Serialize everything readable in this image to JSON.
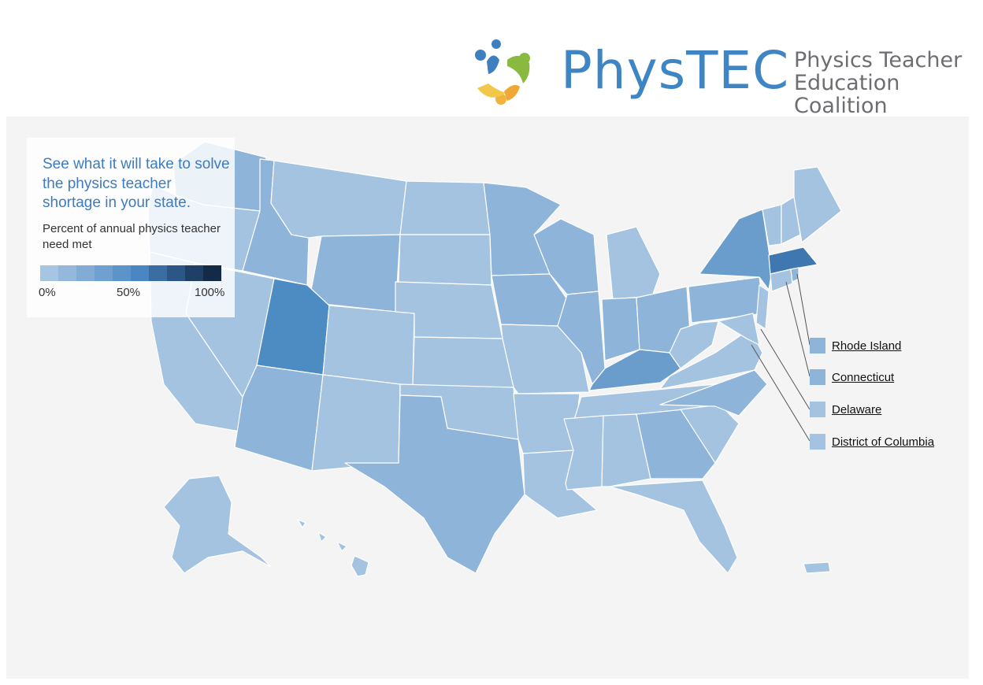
{
  "brand": {
    "name": "PhysTEC",
    "tagline_line1": "Physics Teacher",
    "tagline_line2": "Education Coalition"
  },
  "legend": {
    "heading": "See what it will take to solve the physics teacher shortage in your state.",
    "subheading": "Percent of annual physics teacher need met",
    "ticks": [
      "0%",
      "50%",
      "100%"
    ],
    "scale_colors": [
      "#a5c5e2",
      "#93b8dc",
      "#82acd5",
      "#6fa0cf",
      "#5c93c8",
      "#4a86c1",
      "#3a6ea3",
      "#2b5685",
      "#1e3f66",
      "#142b48"
    ]
  },
  "colors": {
    "background": "#f4f4f4",
    "state_light": "#a3c3e1",
    "state_mid": "#8eb4d9",
    "state_darker": "#6a9dcc",
    "state_dark": "#4d8bc3",
    "state_darkest": "#3f78b1"
  },
  "small_states": [
    {
      "name": "Rhode Island",
      "color": "#8eb4d9"
    },
    {
      "name": "Connecticut",
      "color": "#8eb4d9"
    },
    {
      "name": "Delaware",
      "color": "#a3c3e1"
    },
    {
      "name": "District of Columbia",
      "color": "#a3c3e1"
    }
  ]
}
